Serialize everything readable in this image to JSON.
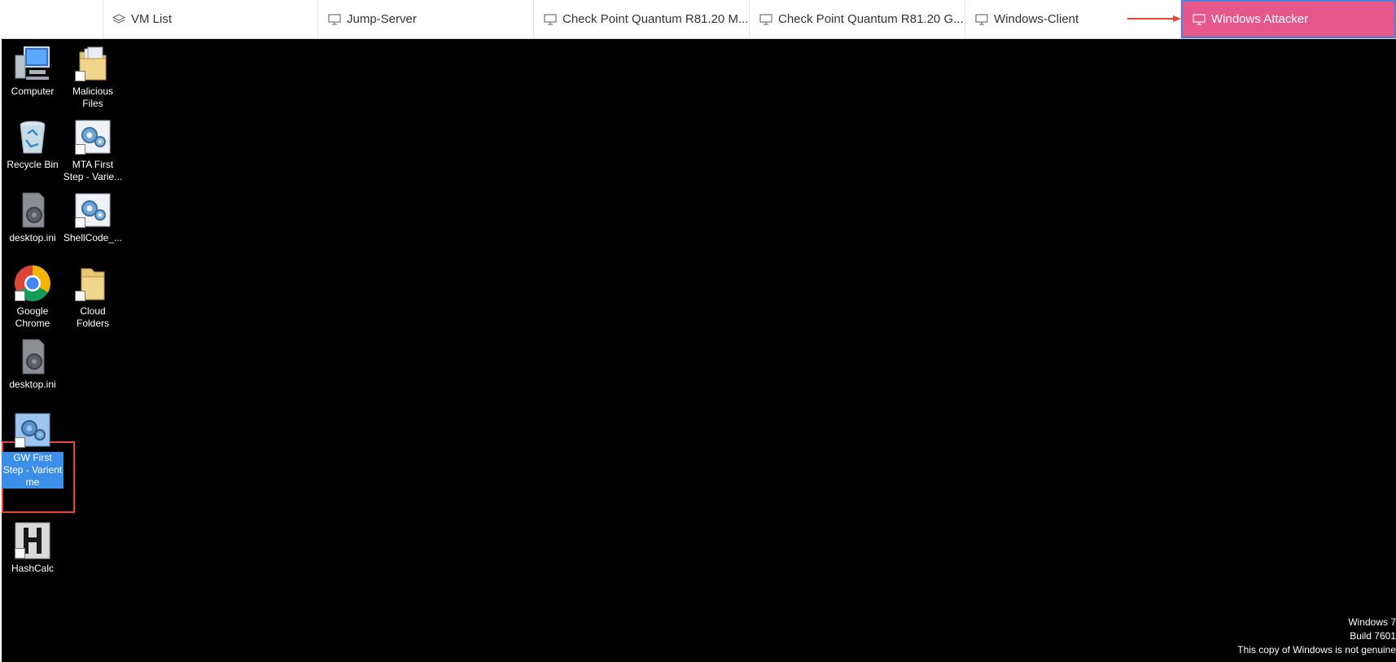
{
  "tabs": [
    {
      "label": "VM List",
      "icon": "layers-icon"
    },
    {
      "label": "Jump-Server",
      "icon": "monitor-icon"
    },
    {
      "label": "Check Point Quantum R81.20 M...",
      "icon": "monitor-icon"
    },
    {
      "label": "Check Point Quantum R81.20 G...",
      "icon": "monitor-icon"
    },
    {
      "label": "Windows-Client",
      "icon": "monitor-icon"
    },
    {
      "label": "Windows Attacker",
      "icon": "monitor-icon",
      "active": true
    }
  ],
  "colors": {
    "active_tab": "#e6588c",
    "active_border": "#4f7fd8",
    "annotation": "#e8463b",
    "desktop_bg": "#000000",
    "selection": "#3b8fe8"
  },
  "desktop": {
    "icons": [
      {
        "label": "Computer",
        "icon": "computer-icon"
      },
      {
        "label": "Malicious Files",
        "icon": "folder-shortcut-icon"
      },
      {
        "label": "Recycle Bin",
        "icon": "recycle-bin-icon"
      },
      {
        "label": "MTA First Step - Varie...",
        "icon": "gear-shortcut-icon"
      },
      {
        "label": "desktop.ini",
        "icon": "settings-file-icon"
      },
      {
        "label": "ShellCode_...",
        "icon": "gear-shortcut-icon"
      },
      {
        "label": "Google Chrome",
        "icon": "chrome-icon"
      },
      {
        "label": "Cloud Folders",
        "icon": "folder-shortcut-icon"
      },
      {
        "label": "desktop.ini",
        "icon": "settings-file-icon"
      },
      {
        "label": "GW First Step - Varient me",
        "icon": "gear-shortcut-icon",
        "selected": true
      },
      {
        "label": "HashCalc",
        "icon": "hashcalc-icon"
      }
    ]
  },
  "watermark": {
    "line1": "Windows 7",
    "line2": "Build 7601",
    "line3": "This copy of Windows is not genuine"
  }
}
